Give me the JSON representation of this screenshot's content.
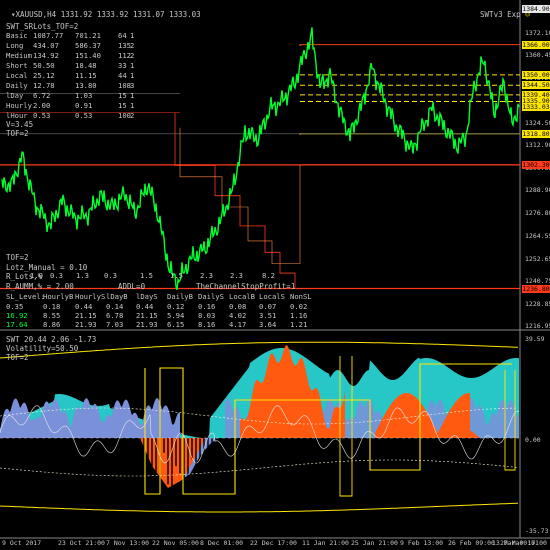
{
  "header": {
    "symbol": "XAUUSD,H4",
    "ohlc": "1331.92 1333.92 1331.07 1333.03",
    "right_label": "SWTv3",
    "right_label2": "Exp"
  },
  "indicator_title": "SWT_SRLots_TOF=2",
  "levels_table": [
    {
      "name": "Basic",
      "a": "1087.77",
      "b": "701.21",
      "c": "64",
      "d": "1"
    },
    {
      "name": "Long",
      "a": "434.07",
      "b": "586.37",
      "c": "135",
      "d": "2"
    },
    {
      "name": "Medium",
      "a": "134.92",
      "b": "151.40",
      "c": "112",
      "d": "2"
    },
    {
      "name": "Short",
      "a": "50.50",
      "b": "18.48",
      "c": "33",
      "d": "1"
    },
    {
      "name": "Local",
      "a": "25.12",
      "b": "11.15",
      "c": "44",
      "d": "1"
    },
    {
      "name": "Daily",
      "a": "12.78",
      "b": "13.80",
      "c": "108",
      "d": "3"
    },
    {
      "name": "lDay",
      "a": "6.72",
      "b": "1.03",
      "c": "15",
      "d": "1"
    },
    {
      "name": "Hourly",
      "a": "2.00",
      "b": "0.91",
      "c": "15",
      "d": "1"
    },
    {
      "name": "lHour",
      "a": "0.53",
      "b": "0.53",
      "c": "100",
      "d": "2"
    }
  ],
  "status_lines": [
    "V=3.45",
    "TOF=2"
  ],
  "lots_block": {
    "tof": "TOF=2",
    "lots_manual": "Lotz_Manual = 0.10",
    "rlots_label": "R_Lots,%",
    "rlots_values": [
      "1.0",
      "0.3",
      "1.3",
      "0.3",
      "1.5",
      "1.5",
      "2.3",
      "2.3",
      "8.2"
    ],
    "r_aumm": "R_AUMM,% = 2.00",
    "addl": "ADDL=0",
    "trend_line": "TheChannelStopProfit=1"
  },
  "sl_table": {
    "headers": [
      "SL_Level:",
      "HourlyB",
      "HourlyS",
      "lDayB",
      "lDayS",
      "DailyB",
      "DailyS",
      "LocalB",
      "LocalS",
      "NonSL"
    ],
    "rows": [
      [
        "0.35",
        "0.18",
        "0.44",
        "0.14",
        "0.44",
        "0.12",
        "0.16",
        "0.08",
        "0.07",
        "0.02"
      ],
      [
        "16.92",
        "8.55",
        "21.15",
        "6.78",
        "21.15",
        "5.94",
        "8.03",
        "4.02",
        "3.51",
        "1.16"
      ],
      [
        "17.64",
        "8.86",
        "21.93",
        "7.03",
        "21.93",
        "6.15",
        "8.16",
        "4.17",
        "3.64",
        "1.21"
      ]
    ]
  },
  "price_axis": [
    "1384.90",
    "1372.10",
    "1360.45",
    "1348.20",
    "1336.25",
    "1324.50",
    "1312.90",
    "1300.85",
    "1288.90",
    "1276.80",
    "1264.55",
    "1252.65",
    "1240.75",
    "1228.85",
    "1216.95"
  ],
  "price_tags": [
    {
      "label": "1384.90",
      "style": "wht"
    },
    {
      "label": "1366.00",
      "style": "yel"
    },
    {
      "label": "1350.00",
      "style": "yel"
    },
    {
      "label": "1344.50",
      "style": "yel"
    },
    {
      "label": "1339.40",
      "style": "yel"
    },
    {
      "label": "1335.90",
      "style": "yel"
    },
    {
      "label": "1333.03",
      "style": "yel"
    },
    {
      "label": "1318.80",
      "style": "yel"
    },
    {
      "label": "1302.30",
      "style": "red"
    },
    {
      "label": "1236.80",
      "style": "red"
    }
  ],
  "osc_header": "SWT 20.44 2.06 -1.73",
  "osc_volatility": "Volatility=50.50",
  "osc_tof": "TOF=2",
  "osc_axis": [
    "39.59",
    "0.00",
    "-35.73"
  ],
  "time_axis": [
    "9 Oct 2017",
    "23 Oct 21:00",
    "7 Nov 13:00",
    "22 Nov 05:00",
    "8 Dec 01:00",
    "22 Dec 17:00",
    "11 Jan 21:00",
    "25 Jan 21:00",
    "9 Feb 13:00",
    "26 Feb 09:00",
    "13 Mar 00:01",
    "27 Mar 17:00"
  ],
  "colors": {
    "background": "#000000",
    "price": "#00ff30",
    "level": "#ffe600",
    "stop": "#ff3a1e",
    "cyan": "#2ad2d2",
    "orange": "#ff5a10",
    "blue": "#7a90d8"
  }
}
